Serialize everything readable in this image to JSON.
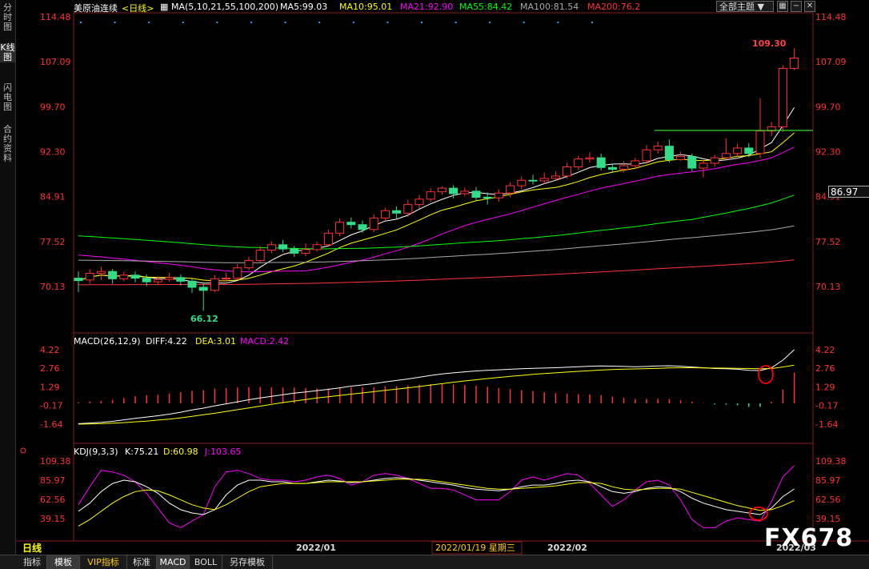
{
  "sidebar": {
    "tabs": [
      {
        "label": "分时图",
        "active": false
      },
      {
        "label": "K线图",
        "active": true
      },
      {
        "label": "闪电图",
        "active": false
      },
      {
        "label": "合约资料",
        "active": false
      }
    ]
  },
  "header": {
    "symbol": "美原油连续",
    "period": "<日线>",
    "ma_params": "MA(5,10,21,55,100,200)",
    "ma_values": [
      {
        "label": "MA5:99.03",
        "color": "#ffffff"
      },
      {
        "label": "MA10:95.01",
        "color": "#ffff00"
      },
      {
        "label": "MA21:92.90",
        "color": "#ff00ff"
      },
      {
        "label": "MA55:84.42",
        "color": "#00ff00"
      },
      {
        "label": "MA100:81.54",
        "color": "#aaaaaa"
      },
      {
        "label": "MA200:76.2",
        "color": "#ff3333"
      }
    ],
    "theme_select": "全部主题"
  },
  "price_panel": {
    "ticks": [
      "114.48",
      "107.09",
      "99.70",
      "92.30",
      "84.91",
      "77.52",
      "70.13"
    ],
    "last_price": "86.97",
    "high_label": "109.30",
    "low_label": "66.12"
  },
  "macd_panel": {
    "title": "MACD(26,12,9)",
    "diff": "DIFF:4.22",
    "dea": "DEA:3.01",
    "macd": "MACD:2.42",
    "ticks": [
      "4.22",
      "2.76",
      "1.29",
      "-0.17",
      "-1.64"
    ]
  },
  "kdj_panel": {
    "title": "KDJ(9,3,3)",
    "k": "K:75.21",
    "d": "D:60.98",
    "j": "J:103.65",
    "ticks": [
      "109.38",
      "85.97",
      "62.56",
      "39.15"
    ]
  },
  "x_axis": {
    "period_label": "日线",
    "labels": [
      "2022/01",
      "2022/02",
      "2022/03"
    ],
    "cursor_date": "2022/01/19 星期三"
  },
  "bottom_tabs": [
    {
      "label": "指标",
      "active": false
    },
    {
      "label": "模板",
      "active": true
    },
    {
      "label": "VIP指标",
      "active": false
    },
    {
      "label": "标准",
      "active": false
    },
    {
      "label": "MACD",
      "active": true
    },
    {
      "label": "BOLL",
      "active": false
    },
    {
      "label": "另存模板",
      "active": false
    }
  ],
  "watermark": "FX678",
  "colors": {
    "up": "#ff3333",
    "down": "#33dd88",
    "ma5": "#ffffff",
    "ma10": "#ffff00",
    "ma21": "#ff00ff",
    "ma55": "#00ff00",
    "ma100": "#aaaaaa",
    "ma200": "#ff3333",
    "axis_label": "#ff3333"
  },
  "chart_data": {
    "type": "candlestick",
    "y_range": [
      66.12,
      114.48
    ],
    "candles": [
      [
        71.5,
        71.1,
        72.6,
        69.2
      ],
      [
        71.2,
        72.3,
        73.0,
        70.6
      ],
      [
        72.3,
        72.6,
        73.4,
        71.2
      ],
      [
        72.6,
        71.4,
        73.0,
        70.6
      ],
      [
        71.4,
        72.0,
        72.6,
        71.0
      ],
      [
        72.0,
        71.5,
        72.6,
        70.8
      ],
      [
        71.5,
        70.9,
        72.1,
        70.2
      ],
      [
        70.9,
        71.3,
        71.8,
        70.4
      ],
      [
        71.3,
        71.6,
        72.4,
        70.9
      ],
      [
        71.6,
        71.0,
        72.1,
        70.3
      ],
      [
        71.0,
        70.0,
        71.4,
        69.1
      ],
      [
        70.0,
        69.5,
        70.7,
        66.12
      ],
      [
        69.5,
        71.4,
        72.0,
        69.2
      ],
      [
        71.4,
        71.5,
        72.4,
        70.9
      ],
      [
        71.5,
        73.2,
        73.8,
        71.2
      ],
      [
        73.2,
        74.4,
        75.0,
        72.8
      ],
      [
        74.4,
        76.1,
        76.8,
        74.0
      ],
      [
        76.1,
        77.0,
        77.6,
        75.6
      ],
      [
        77.0,
        76.3,
        77.8,
        75.8
      ],
      [
        76.3,
        75.6,
        76.8,
        75.0
      ],
      [
        75.6,
        76.2,
        77.2,
        75.1
      ],
      [
        76.2,
        77.0,
        77.5,
        75.9
      ],
      [
        77.0,
        78.9,
        79.5,
        76.8
      ],
      [
        78.9,
        80.7,
        81.3,
        78.4
      ],
      [
        80.7,
        80.3,
        81.5,
        79.7
      ],
      [
        80.3,
        79.5,
        81.0,
        79.0
      ],
      [
        79.5,
        81.4,
        82.0,
        79.1
      ],
      [
        81.4,
        82.6,
        83.1,
        80.9
      ],
      [
        82.6,
        82.2,
        83.3,
        81.3
      ],
      [
        82.2,
        83.6,
        84.4,
        81.6
      ],
      [
        83.6,
        84.5,
        85.2,
        82.9
      ],
      [
        84.5,
        85.7,
        86.3,
        84.0
      ],
      [
        85.7,
        86.3,
        86.6,
        85.2
      ],
      [
        86.3,
        85.4,
        86.8,
        84.6
      ],
      [
        85.4,
        85.8,
        86.4,
        85.0
      ],
      [
        85.8,
        84.8,
        86.5,
        84.2
      ],
      [
        84.8,
        84.7,
        85.6,
        83.6
      ],
      [
        84.7,
        85.5,
        86.1,
        84.1
      ],
      [
        85.5,
        86.7,
        87.3,
        84.8
      ],
      [
        86.7,
        87.6,
        88.2,
        86.1
      ],
      [
        87.6,
        87.5,
        88.5,
        86.9
      ],
      [
        87.5,
        87.9,
        88.9,
        87.0
      ],
      [
        87.9,
        88.3,
        89.1,
        87.6
      ],
      [
        88.3,
        89.8,
        90.5,
        87.9
      ],
      [
        89.8,
        91.1,
        91.6,
        89.3
      ],
      [
        91.1,
        91.3,
        92.2,
        90.5
      ],
      [
        91.3,
        89.7,
        92.0,
        89.2
      ],
      [
        89.7,
        89.4,
        90.3,
        88.8
      ],
      [
        89.4,
        90.0,
        90.8,
        88.9
      ],
      [
        90.0,
        90.8,
        91.3,
        89.4
      ],
      [
        90.8,
        92.6,
        93.4,
        90.3
      ],
      [
        92.6,
        93.2,
        94.0,
        92.0
      ],
      [
        93.2,
        91.0,
        94.3,
        90.5
      ],
      [
        91.0,
        91.5,
        92.3,
        90.8
      ],
      [
        91.5,
        89.6,
        92.0,
        89.1
      ],
      [
        89.6,
        90.4,
        90.9,
        88.1
      ],
      [
        90.4,
        91.3,
        91.8,
        89.8
      ],
      [
        91.3,
        92.0,
        94.5,
        91.0
      ],
      [
        92.0,
        92.9,
        93.6,
        91.5
      ],
      [
        92.9,
        92.0,
        93.7,
        91.4
      ],
      [
        92.0,
        95.7,
        101.1,
        91.3
      ],
      [
        95.7,
        96.4,
        97.2,
        94.9
      ],
      [
        96.4,
        106.0,
        106.5,
        95.6
      ],
      [
        106.0,
        107.7,
        109.3,
        105.7
      ]
    ],
    "macd": {
      "diff": [
        -1.6,
        -1.55,
        -1.5,
        -1.42,
        -1.3,
        -1.18,
        -1.08,
        -0.98,
        -0.85,
        -0.7,
        -0.52,
        -0.38,
        -0.2,
        -0.04,
        0.12,
        0.28,
        0.42,
        0.55,
        0.68,
        0.8,
        0.9,
        1.0,
        1.1,
        1.22,
        1.35,
        1.45,
        1.55,
        1.68,
        1.8,
        1.92,
        2.05,
        2.2,
        2.32,
        2.4,
        2.48,
        2.55,
        2.6,
        2.64,
        2.68,
        2.72,
        2.76,
        2.78,
        2.8,
        2.84,
        2.88,
        2.92,
        2.94,
        2.93,
        2.9,
        2.88,
        2.9,
        2.94,
        2.96,
        2.92,
        2.86,
        2.8,
        2.74,
        2.72,
        2.68,
        2.6,
        2.58,
        2.8,
        3.4,
        4.22
      ],
      "dea": [
        -1.64,
        -1.62,
        -1.6,
        -1.56,
        -1.52,
        -1.46,
        -1.4,
        -1.32,
        -1.24,
        -1.14,
        -1.02,
        -0.9,
        -0.78,
        -0.64,
        -0.5,
        -0.36,
        -0.22,
        -0.08,
        0.06,
        0.18,
        0.3,
        0.42,
        0.52,
        0.62,
        0.72,
        0.82,
        0.92,
        1.02,
        1.12,
        1.22,
        1.32,
        1.44,
        1.55,
        1.66,
        1.76,
        1.86,
        1.95,
        2.04,
        2.12,
        2.2,
        2.28,
        2.34,
        2.4,
        2.46,
        2.52,
        2.57,
        2.62,
        2.66,
        2.69,
        2.71,
        2.73,
        2.76,
        2.79,
        2.8,
        2.8,
        2.79,
        2.78,
        2.77,
        2.76,
        2.74,
        2.72,
        2.74,
        2.86,
        3.01
      ],
      "bar": [
        0.08,
        0.14,
        0.2,
        0.28,
        0.42,
        0.56,
        0.64,
        0.68,
        0.78,
        0.88,
        0.98,
        1.04,
        1.16,
        1.2,
        1.24,
        1.28,
        1.28,
        1.26,
        1.24,
        1.24,
        1.2,
        1.16,
        1.16,
        1.2,
        1.26,
        1.26,
        1.26,
        1.32,
        1.36,
        1.4,
        1.46,
        1.52,
        1.54,
        1.48,
        1.44,
        1.38,
        1.3,
        1.2,
        1.12,
        1.04,
        0.96,
        0.88,
        0.8,
        0.76,
        0.72,
        0.7,
        0.64,
        0.54,
        0.42,
        0.34,
        0.34,
        0.36,
        0.34,
        0.24,
        0.12,
        0.02,
        -0.08,
        -0.1,
        -0.16,
        -0.28,
        -0.28,
        0.12,
        1.08,
        2.42
      ]
    },
    "kdj": {
      "k": [
        48,
        58,
        72,
        82,
        86,
        84,
        78,
        70,
        58,
        50,
        46,
        44,
        50,
        68,
        80,
        86,
        86,
        84,
        84,
        82,
        82,
        84,
        86,
        85,
        83,
        84,
        86,
        88,
        89,
        88,
        86,
        84,
        82,
        80,
        77,
        75,
        74,
        73,
        75,
        78,
        80,
        80,
        82,
        85,
        86,
        84,
        78,
        72,
        70,
        72,
        76,
        78,
        77,
        72,
        64,
        58,
        54,
        50,
        48,
        46,
        44,
        52,
        66,
        75.21
      ],
      "d": [
        30,
        38,
        48,
        58,
        66,
        72,
        74,
        73,
        68,
        62,
        56,
        52,
        50,
        56,
        64,
        72,
        78,
        80,
        82,
        82,
        82,
        83,
        84,
        84,
        84,
        84,
        85,
        86,
        87,
        87,
        87,
        86,
        84,
        82,
        80,
        78,
        76,
        75,
        75,
        76,
        77,
        78,
        79,
        81,
        83,
        83,
        82,
        78,
        75,
        74,
        75,
        76,
        76,
        75,
        71,
        67,
        63,
        59,
        55,
        52,
        49,
        50,
        55,
        60.98
      ],
      "j": [
        56,
        78,
        98,
        96,
        92,
        84,
        70,
        52,
        34,
        28,
        36,
        44,
        78,
        96,
        98,
        94,
        88,
        86,
        86,
        84,
        86,
        90,
        92,
        88,
        80,
        84,
        92,
        94,
        92,
        88,
        82,
        76,
        76,
        74,
        68,
        62,
        62,
        62,
        72,
        86,
        90,
        86,
        90,
        94,
        92,
        82,
        68,
        54,
        62,
        74,
        84,
        86,
        80,
        62,
        38,
        26,
        28,
        36,
        40,
        38,
        36,
        60,
        90,
        103.65
      ]
    }
  }
}
